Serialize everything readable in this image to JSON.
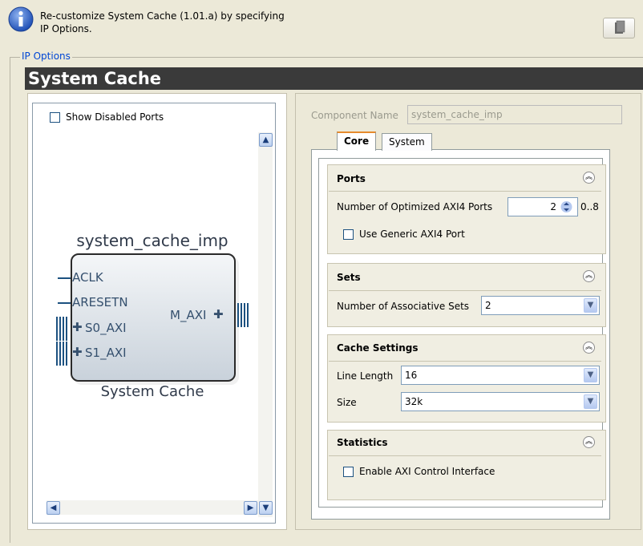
{
  "header": {
    "line1": "Re-customize System Cache (1.01.a) by specifying",
    "line2": "IP Options."
  },
  "ip_options_label": "IP Options",
  "page_title": "System Cache",
  "left_panel": {
    "show_disabled_ports_label": "Show Disabled Ports",
    "show_disabled_ports_checked": false,
    "symbol": {
      "instance_name": "system_cache_imp",
      "component_label": "System Cache",
      "left_ports": [
        "ACLK",
        "ARESETN",
        "S0_AXI",
        "S1_AXI"
      ],
      "right_ports": [
        "M_AXI"
      ]
    }
  },
  "right_panel": {
    "component_name_label": "Component Name",
    "component_name_value": "system_cache_imp",
    "tabs": [
      {
        "label": "Core",
        "active": true
      },
      {
        "label": "System",
        "active": false
      }
    ],
    "groups": {
      "ports": {
        "title": "Ports",
        "num_optimized_label": "Number of Optimized AXI4 Ports",
        "num_optimized_value": "2",
        "num_optimized_range": "0..8",
        "use_generic_label": "Use Generic AXI4 Port",
        "use_generic_checked": false
      },
      "sets": {
        "title": "Sets",
        "assoc_label": "Number of Associative Sets",
        "assoc_value": "2"
      },
      "cache_settings": {
        "title": "Cache Settings",
        "line_length_label": "Line Length",
        "line_length_value": "16",
        "size_label": "Size",
        "size_value": "32k"
      },
      "statistics": {
        "title": "Statistics",
        "enable_axi_label": "Enable AXI Control Interface",
        "enable_axi_checked": false
      }
    }
  }
}
